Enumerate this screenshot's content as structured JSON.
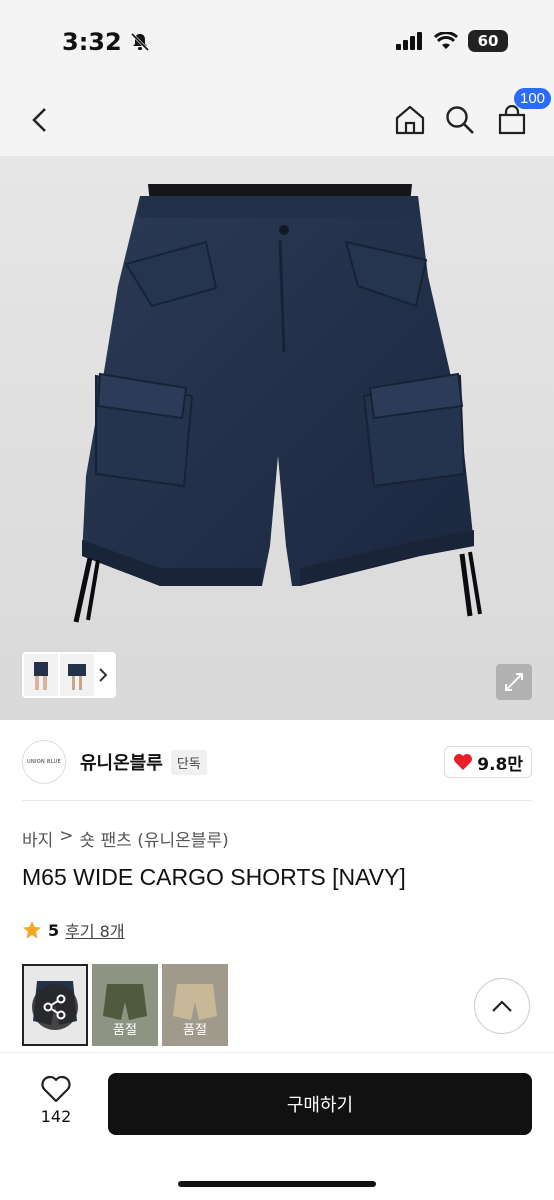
{
  "status": {
    "time": "3:32",
    "battery": "60",
    "icons": [
      "bell-slash-icon",
      "signal-icon",
      "wifi-icon"
    ]
  },
  "nav": {
    "cart_count": "100",
    "icons": [
      "back-icon",
      "home-icon",
      "search-icon",
      "cart-icon"
    ]
  },
  "colors": {
    "navy": "#23314a",
    "badge_blue": "#2b6cf6",
    "heart_red": "#e8202a",
    "star_orange": "#f5a623"
  },
  "shop": {
    "logo_text": "UNION BLUE",
    "name": "유니온블루",
    "exclusive_label": "단독",
    "likes": "9.8만"
  },
  "breadcrumb": {
    "category": "바지",
    "separator": ">",
    "subcategory": "숏 팬츠 (유니온블루)"
  },
  "product": {
    "title": "M65 WIDE CARGO SHORTS [NAVY]",
    "rating": "5",
    "review_label": "후기 8개"
  },
  "variants": [
    {
      "name": "navy",
      "label": ""
    },
    {
      "name": "olive",
      "label": "품절"
    },
    {
      "name": "beige",
      "label": "품절"
    }
  ],
  "bottom": {
    "wish_count": "142",
    "buy_label": "구매하기"
  }
}
